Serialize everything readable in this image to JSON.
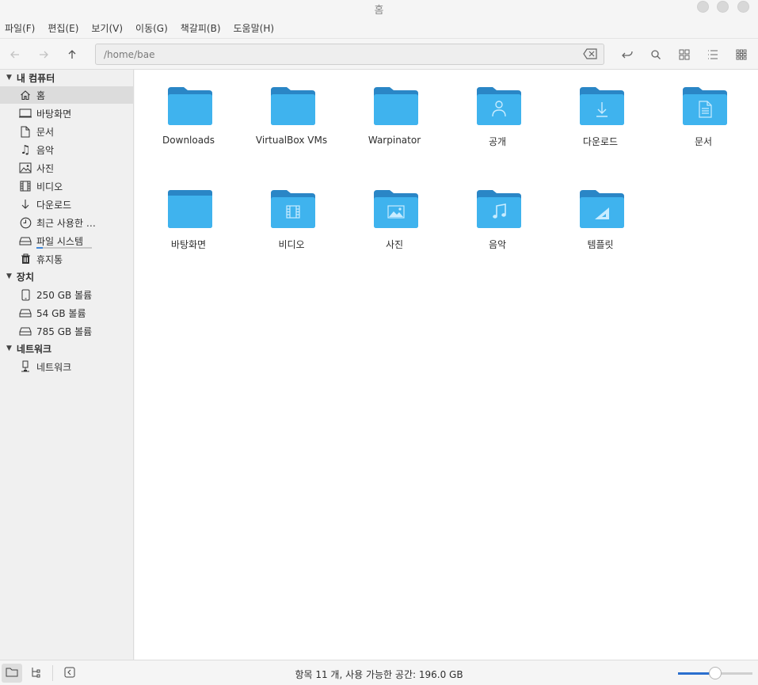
{
  "window": {
    "title": "홈"
  },
  "menu": [
    "파일(F)",
    "편집(E)",
    "보기(V)",
    "이동(G)",
    "책갈피(B)",
    "도움말(H)"
  ],
  "location": {
    "path": "/home/bae"
  },
  "sidebar": {
    "sections": [
      {
        "label": "내 컴퓨터",
        "items": [
          {
            "label": "홈",
            "icon": "home-icon",
            "selected": true
          },
          {
            "label": "바탕화면",
            "icon": "desktop-icon"
          },
          {
            "label": "문서",
            "icon": "document-icon"
          },
          {
            "label": "음악",
            "icon": "music-icon"
          },
          {
            "label": "사진",
            "icon": "picture-icon"
          },
          {
            "label": "비디오",
            "icon": "video-icon"
          },
          {
            "label": "다운로드",
            "icon": "download-icon"
          },
          {
            "label": "최근 사용한 …",
            "icon": "recent-icon"
          },
          {
            "label": "파일 시스템",
            "icon": "drive-icon",
            "usage": 0.11
          },
          {
            "label": "휴지통",
            "icon": "trash-icon"
          }
        ]
      },
      {
        "label": "장치",
        "items": [
          {
            "label": "250 GB 볼륨",
            "icon": "phone-drive-icon"
          },
          {
            "label": "54 GB 볼륨",
            "icon": "drive-icon"
          },
          {
            "label": "785 GB 볼륨",
            "icon": "drive-icon"
          }
        ]
      },
      {
        "label": "네트워크",
        "items": [
          {
            "label": "네트워크",
            "icon": "network-icon"
          }
        ]
      }
    ]
  },
  "files": [
    {
      "name": "Downloads",
      "emblem": "none"
    },
    {
      "name": "VirtualBox VMs",
      "emblem": "none"
    },
    {
      "name": "Warpinator",
      "emblem": "none"
    },
    {
      "name": "공개",
      "emblem": "person"
    },
    {
      "name": "다운로드",
      "emblem": "download"
    },
    {
      "name": "문서",
      "emblem": "document"
    },
    {
      "name": "바탕화면",
      "emblem": "desktop"
    },
    {
      "name": "비디오",
      "emblem": "video"
    },
    {
      "name": "사진",
      "emblem": "picture"
    },
    {
      "name": "음악",
      "emblem": "music"
    },
    {
      "name": "템플릿",
      "emblem": "template"
    }
  ],
  "status": {
    "text": "항목 11 개, 사용 가능한 공간: 196.0 GB",
    "zoom": 0.5
  },
  "colors": {
    "folder_body": "#3fb3ee",
    "folder_tab": "#2a86c6",
    "accent": "#2a6fce",
    "selection": "#dcdcdc"
  }
}
